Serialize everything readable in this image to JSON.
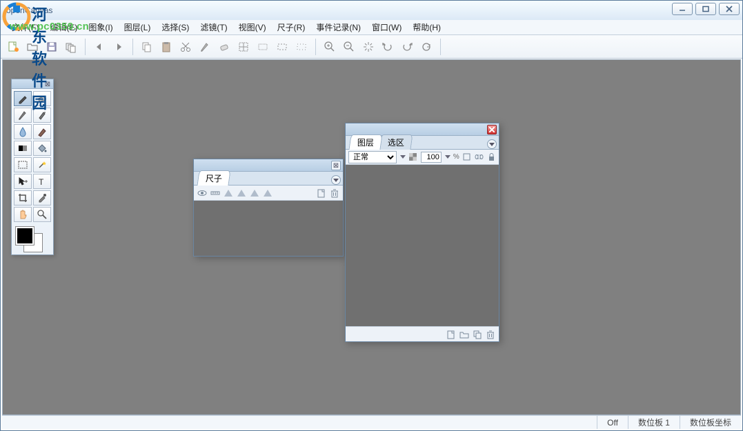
{
  "watermark": {
    "brand": "河东软件园",
    "url": "www.pc0359.cn"
  },
  "window": {
    "title": "openCanvas"
  },
  "menu": {
    "file": "文件(F)",
    "edit": "编辑(E)",
    "image": "图象(I)",
    "layer": "图层(L)",
    "select": "选择(S)",
    "filter": "滤镜(T)",
    "view": "视图(V)",
    "ruler": "尺子(R)",
    "event": "事件记录(N)",
    "window": "窗口(W)",
    "help": "帮助(H)"
  },
  "toolbar": {
    "new": "new",
    "open": "open",
    "save": "save",
    "history": "history",
    "prev": "prev",
    "next": "next",
    "copy": "copy",
    "paste": "paste",
    "cut": "cut",
    "brush": "brush",
    "eraser": "eraser",
    "crop": "crop",
    "marq1": "select-solid",
    "marq2": "select-dash",
    "marq3": "select-dot",
    "zoomin": "zoom-in",
    "zoomout": "zoom-out",
    "burst": "navigator",
    "undo": "undo",
    "redo": "redo",
    "refresh": "refresh"
  },
  "ruler_panel": {
    "tab": "尺子"
  },
  "layers_panel": {
    "tab_layer": "图层",
    "tab_select": "选区",
    "blend_mode": "正常",
    "opacity": "100",
    "pct": "%"
  },
  "status": {
    "off": "Off",
    "tablet": "数位板 1",
    "tablet_coord": "数位板坐标"
  }
}
